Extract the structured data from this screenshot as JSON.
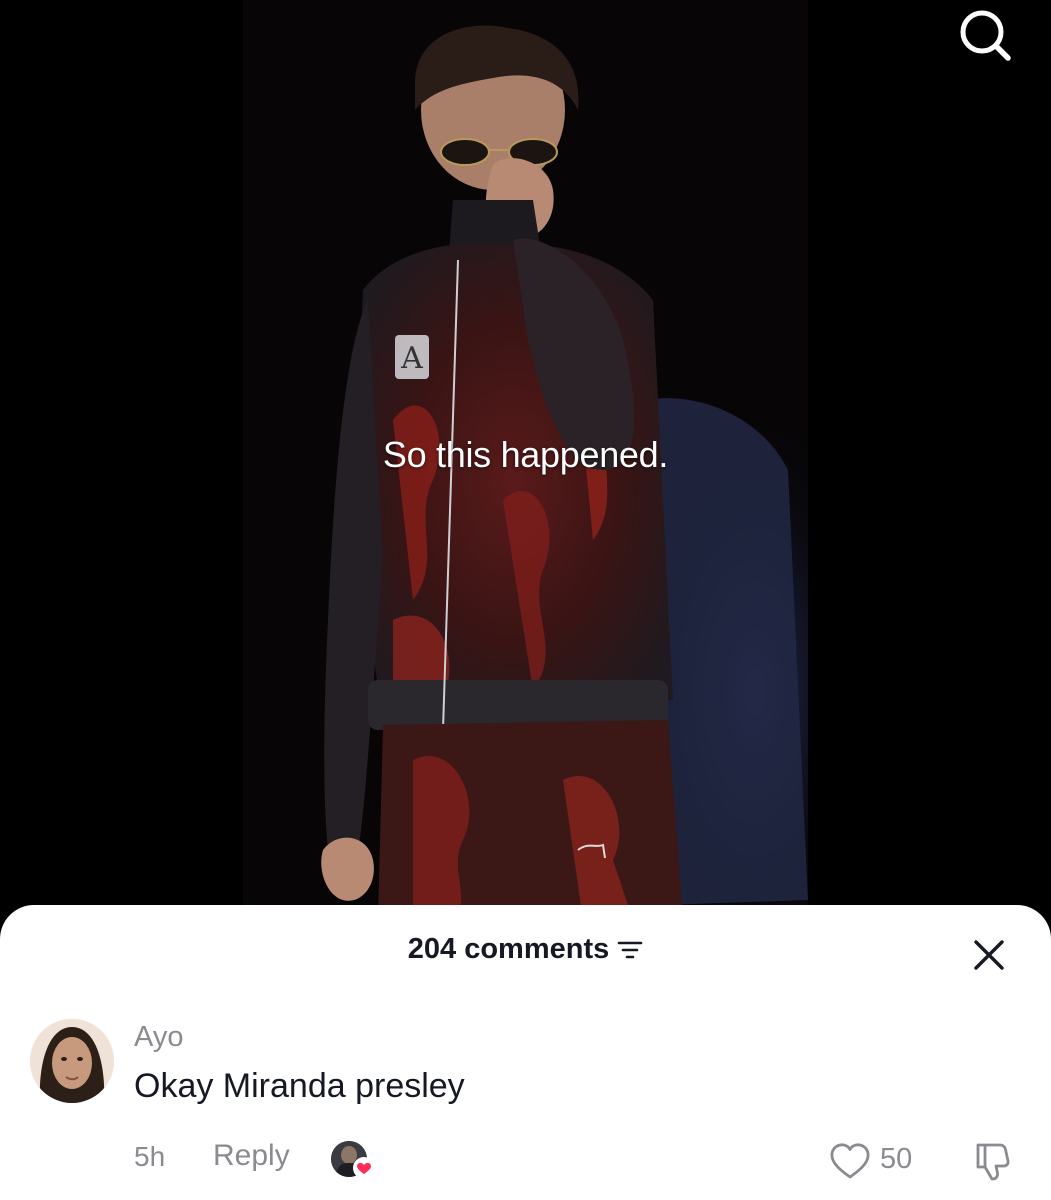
{
  "video": {
    "caption": "So this happened."
  },
  "icons": {
    "search": "search-icon",
    "close": "close-icon",
    "filter": "filter-icon",
    "like": "heart-outline-icon",
    "dislike": "thumbs-down-icon",
    "creator_liked_heart": "heart-filled-icon"
  },
  "comments_sheet": {
    "count_label": "204 comments",
    "comment": {
      "username": "Ayo",
      "text": "Okay Miranda presley",
      "time": "5h",
      "reply_label": "Reply",
      "like_count": "50"
    }
  },
  "colors": {
    "sheet_bg": "#ffffff",
    "primary_text": "#161823",
    "secondary_text": "#8a8b91",
    "heart_red": "#fe2c55"
  }
}
